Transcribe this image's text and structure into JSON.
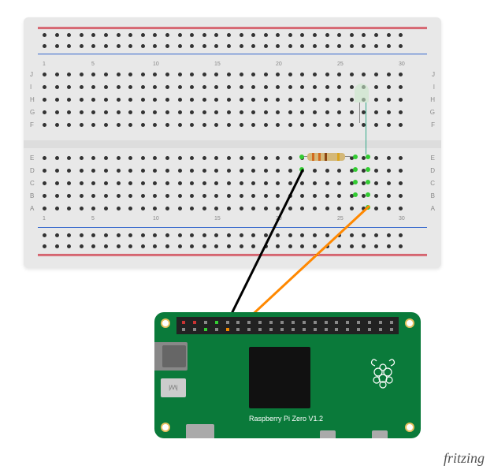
{
  "diagram": {
    "pi_label": "Raspberry Pi Zero V1.2",
    "cam_label": "|/\\/\\|",
    "watermark": "fritzing"
  },
  "breadboard": {
    "row_labels_top": [
      "J",
      "I",
      "H",
      "G",
      "F"
    ],
    "row_labels_bottom": [
      "E",
      "D",
      "C",
      "B",
      "A"
    ],
    "col_numbers": [
      1,
      5,
      10,
      15,
      20,
      25,
      30
    ]
  },
  "components": {
    "led": {
      "type": "LED",
      "color": "blue",
      "anode_col": 28,
      "cathode_col": 29,
      "row": "F"
    },
    "resistor": {
      "type": "resistor",
      "value_ohms": 330,
      "bands": [
        "orange",
        "orange",
        "brown",
        "gold"
      ],
      "from_col": 24,
      "to_col": 28,
      "row": "D"
    },
    "wires": [
      {
        "name": "gnd",
        "color": "#000000",
        "from": "breadboard col24 rowB",
        "to": "pi GPIO pin6 GND"
      },
      {
        "name": "signal",
        "color": "#ff8800",
        "from": "breadboard col29 rowA",
        "to": "pi GPIO pin7"
      }
    ]
  }
}
